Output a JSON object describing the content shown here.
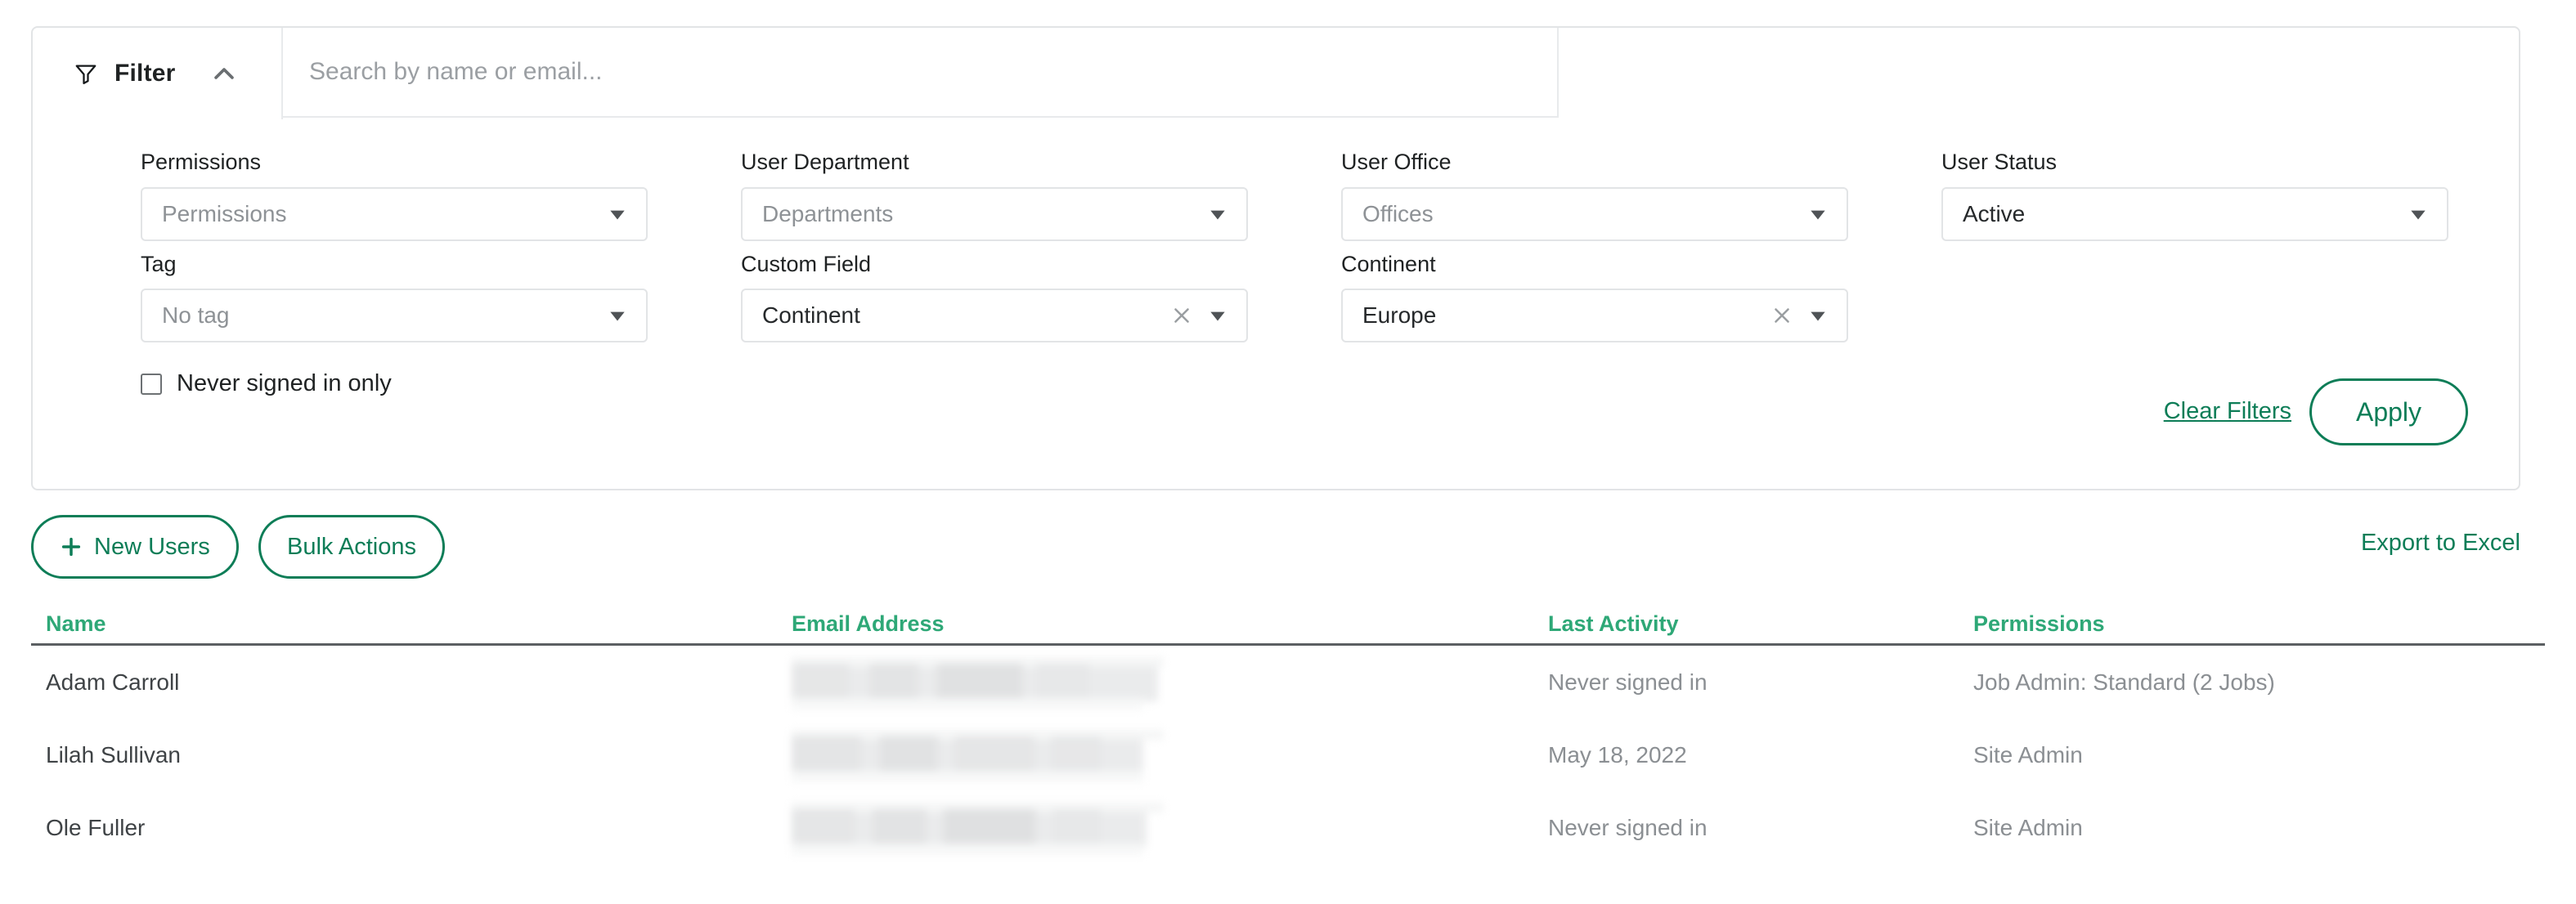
{
  "theme": {
    "accent_green": "#0d7d57",
    "header_green": "#2ea877",
    "border_gray": "#e2e4e6",
    "text_dark": "#1f2223",
    "text_muted": "#8b8f93"
  },
  "filter_panel": {
    "title": "Filter",
    "funnel_icon": "funnel-icon",
    "collapse_icon": "chevron-up-icon",
    "search": {
      "placeholder": "Search by name or email...",
      "value": ""
    },
    "fields": [
      {
        "label": "Permissions",
        "value": "Permissions",
        "filled": false,
        "clearable": false,
        "name": "permissions"
      },
      {
        "label": "User Department",
        "value": "Departments",
        "filled": false,
        "clearable": false,
        "name": "user-department"
      },
      {
        "label": "User Office",
        "value": "Offices",
        "filled": false,
        "clearable": false,
        "name": "user-office"
      },
      {
        "label": "User Status",
        "value": "Active",
        "filled": true,
        "clearable": false,
        "name": "user-status"
      },
      {
        "label": "Tag",
        "value": "No tag",
        "filled": false,
        "clearable": false,
        "name": "tag"
      },
      {
        "label": "Custom Field",
        "value": "Continent",
        "filled": true,
        "clearable": true,
        "name": "custom-field"
      },
      {
        "label": "Continent",
        "value": "Europe",
        "filled": true,
        "clearable": true,
        "name": "continent"
      }
    ],
    "never_signed_in_checkbox": {
      "label": "Never signed in only",
      "checked": false
    },
    "clear_filters_label": "Clear Filters",
    "apply_label": "Apply"
  },
  "action_bar": {
    "new_users_label": "New Users",
    "new_users_icon": "plus-icon",
    "bulk_actions_label": "Bulk Actions",
    "export_label": "Export to Excel"
  },
  "table": {
    "columns": [
      "Name",
      "Email Address",
      "Last Activity",
      "Permissions"
    ],
    "rows": [
      {
        "name": "Adam Carroll",
        "email": "",
        "last_activity": "Never signed in",
        "permissions": "Job Admin: Standard (2 Jobs)"
      },
      {
        "name": "Lilah Sullivan",
        "email": "",
        "last_activity": "May 18, 2022",
        "permissions": "Site Admin"
      },
      {
        "name": "Ole Fuller",
        "email": "",
        "last_activity": "Never signed in",
        "permissions": "Site Admin"
      }
    ]
  }
}
